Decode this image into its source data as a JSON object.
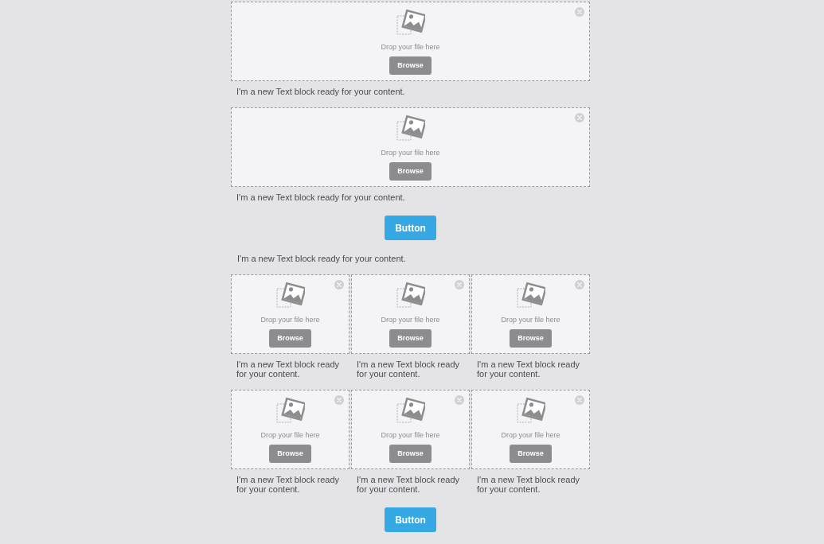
{
  "blocks": [
    {
      "kind": "columns",
      "columns": [
        {
          "drop_hint": "Drop your file here",
          "browse": "Browse",
          "text": "I'm a new Text block ready for your content."
        }
      ]
    },
    {
      "kind": "columns",
      "columns": [
        {
          "drop_hint": "Drop your file here",
          "browse": "Browse",
          "text": "I'm a new Text block ready for your content."
        }
      ]
    },
    {
      "kind": "button",
      "label": "Button"
    },
    {
      "kind": "text",
      "text": "I'm a new Text block ready for your content."
    },
    {
      "kind": "columns",
      "columns": [
        {
          "drop_hint": "Drop your file here",
          "browse": "Browse",
          "text": "I'm a new Text block ready for your content."
        },
        {
          "drop_hint": "Drop your file here",
          "browse": "Browse",
          "text": "I'm a new Text block ready for your content."
        },
        {
          "drop_hint": "Drop your file here",
          "browse": "Browse",
          "text": "I'm a new Text block ready for your content."
        }
      ]
    },
    {
      "kind": "columns",
      "columns": [
        {
          "drop_hint": "Drop your file here",
          "browse": "Browse",
          "text": "I'm a new Text block ready for your content."
        },
        {
          "drop_hint": "Drop your file here",
          "browse": "Browse",
          "text": "I'm a new Text block ready for your content."
        },
        {
          "drop_hint": "Drop your file here",
          "browse": "Browse",
          "text": "I'm a new Text block ready for your content."
        }
      ]
    },
    {
      "kind": "button",
      "label": "Button"
    }
  ]
}
